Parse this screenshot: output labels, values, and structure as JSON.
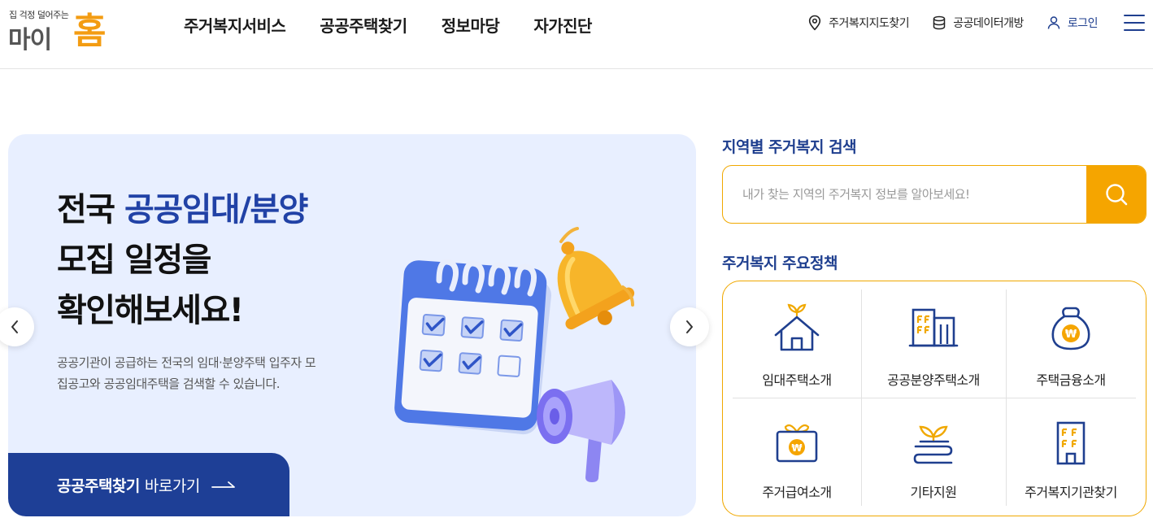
{
  "header": {
    "logo_tagline": "집 걱정 덜어주는",
    "logo_main": "마이",
    "logo_home": "홈",
    "nav": [
      "주거복지서비스",
      "공공주택찾기",
      "정보마당",
      "자가진단"
    ],
    "util": {
      "map": "주거복지지도찾기",
      "data": "공공데이터개방",
      "login": "로그인"
    }
  },
  "banner": {
    "title_line1_prefix": "전국 ",
    "title_line1_accent": "공공임대/분양",
    "title_line2": "모집 일정을",
    "title_line3": "확인해보세요!",
    "description": "공공기관이 공급하는 전국의 임대·분양주택 입주자 모집공고와 공공임대주택을 검색할 수 있습니다.",
    "cta_bold": "공공주택찾기",
    "cta_rest": "바로가기"
  },
  "search": {
    "title": "지역별 주거복지 검색",
    "placeholder": "내가 찾는 지역의 주거복지 정보를 알아보세요!"
  },
  "policies": {
    "title": "주거복지 주요정책",
    "items": [
      {
        "label": "임대주택소개",
        "icon": "house-sprout-icon"
      },
      {
        "label": "공공분양주택소개",
        "icon": "buildings-icon"
      },
      {
        "label": "주택금융소개",
        "icon": "money-bag-icon"
      },
      {
        "label": "주거급여소개",
        "icon": "won-gift-icon"
      },
      {
        "label": "기타지원",
        "icon": "sprout-hand-icon"
      },
      {
        "label": "주거복지기관찾기",
        "icon": "office-building-icon"
      }
    ]
  },
  "colors": {
    "brand_navy": "#1f3f8f",
    "brand_orange": "#f5a500",
    "banner_bg": "#e8efff",
    "cta_bg": "#1e3f96"
  }
}
